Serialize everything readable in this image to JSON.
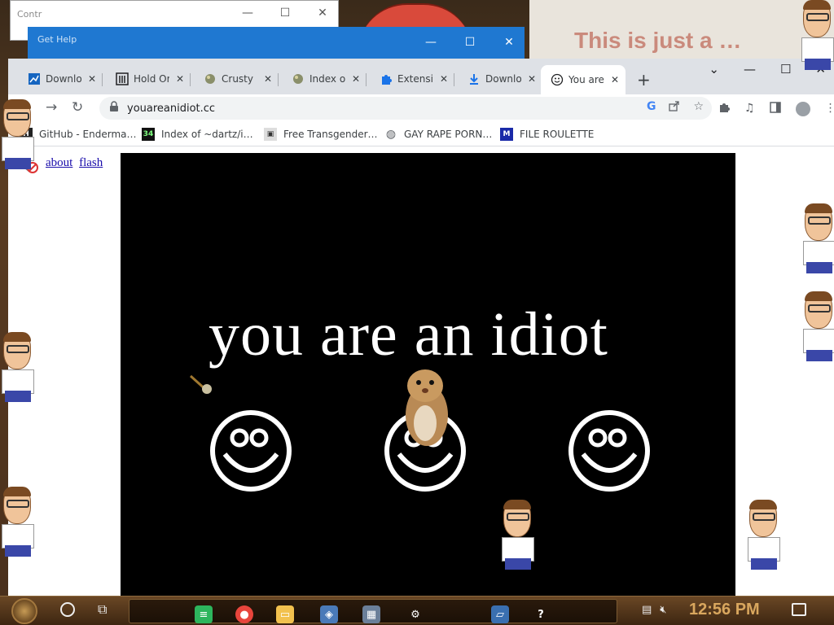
{
  "background_windows": {
    "win1_title": "Contr",
    "win2_title": "Get Help",
    "banner_text": "This is just a …"
  },
  "window_controls": {
    "minimize": "—",
    "maximize": "☐",
    "close": "✕",
    "dropdown": "⌄"
  },
  "tabs": [
    {
      "label": "Downlo",
      "icon": "chart-icon",
      "active": false
    },
    {
      "label": "Hold Or",
      "icon": "archive-icon",
      "active": false
    },
    {
      "label": "Crusty",
      "icon": "puzzle-sprite-icon",
      "active": false
    },
    {
      "label": "Index o",
      "icon": "puzzle-sprite-icon",
      "active": false
    },
    {
      "label": "Extensi",
      "icon": "extension-icon",
      "active": false
    },
    {
      "label": "Downlo",
      "icon": "download-icon",
      "active": false
    },
    {
      "label": "You are",
      "icon": "smiley-icon",
      "active": true
    }
  ],
  "toolbar": {
    "back": "←",
    "forward": "→",
    "reload": "↻",
    "url": "youareanidiot.cc",
    "new_tab": "+"
  },
  "bookmarks": [
    {
      "label": "GitHub - Enderma…",
      "icon": "github-icon"
    },
    {
      "label": "Index of ~dartz/i…",
      "icon": "index-icon"
    },
    {
      "label": "Free Transgender…",
      "icon": "file-icon"
    },
    {
      "label": "GAY RAPE PORN…",
      "icon": "globe-icon"
    },
    {
      "label": "FILE ROULETTE",
      "icon": "mft-icon"
    }
  ],
  "page": {
    "link_about": "about",
    "link_flash": "flash",
    "headline": "you are an idiot"
  },
  "taskbar": {
    "clock": "12:56 PM"
  },
  "colors": {
    "stage": "#000000",
    "link": "#1a0dab",
    "clock": "#d9a75e",
    "chrome_tabstrip": "#dee1e6"
  }
}
